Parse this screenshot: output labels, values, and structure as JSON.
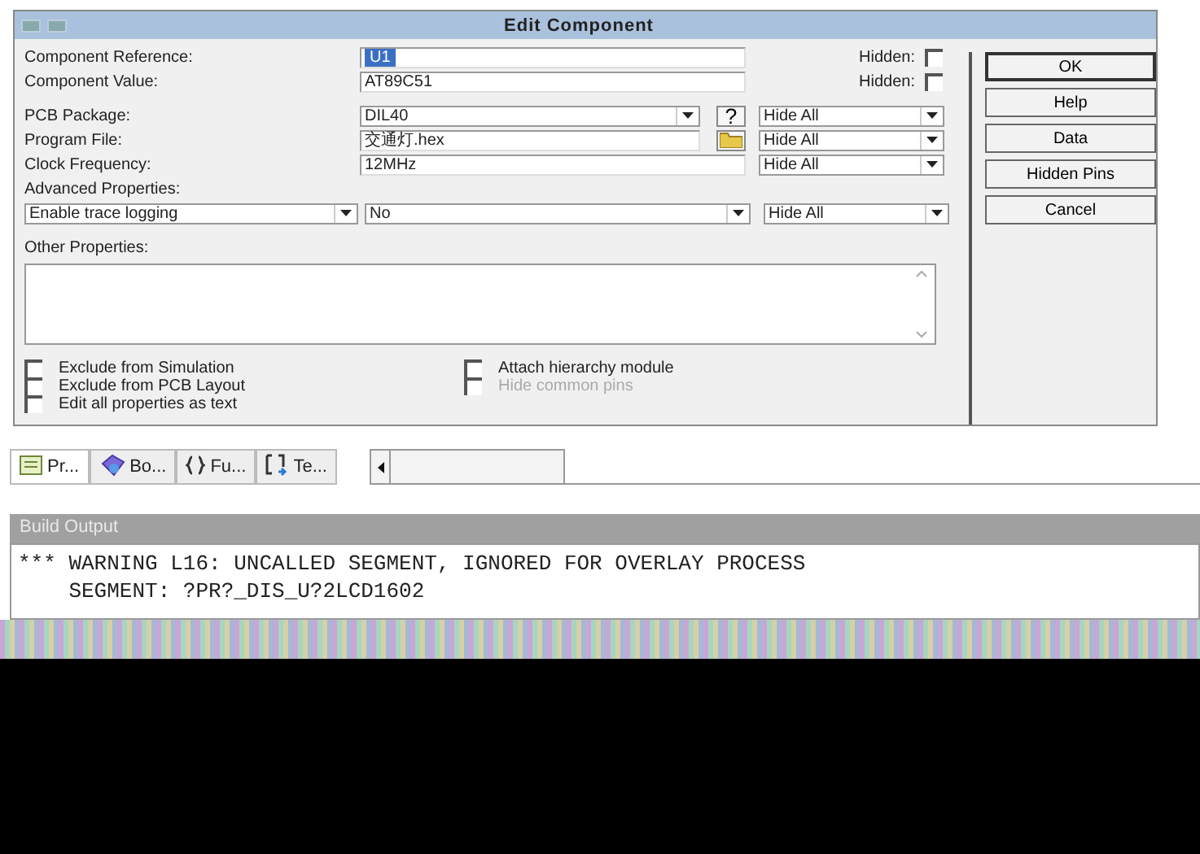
{
  "window": {
    "title": "Edit Component"
  },
  "fields": [
    {
      "kind": "text",
      "label": "Component Reference:",
      "value": "U1",
      "highlighted": true,
      "hidden_label": "Hidden:",
      "hidden_checked": false
    },
    {
      "kind": "text",
      "label": "Component Value:",
      "value": "AT89C51",
      "highlighted": false,
      "hidden_label": "Hidden:",
      "hidden_checked": false
    },
    {
      "kind": "package",
      "label": "PCB Package:",
      "value": "DIL40",
      "button": "?",
      "visibility": "Hide All"
    },
    {
      "kind": "file",
      "label": "Program File:",
      "value": "交通灯.hex",
      "visibility": "Hide All"
    },
    {
      "kind": "plain",
      "label": "Clock Frequency:",
      "value": "12MHz",
      "visibility": "Hide All"
    }
  ],
  "advanced": {
    "label": "Advanced Properties:",
    "property": "Enable trace logging",
    "value": "No",
    "visibility": "Hide All"
  },
  "other_properties": {
    "label": "Other Properties:"
  },
  "option_columns": [
    [
      {
        "label": "Exclude from Simulation",
        "checked": false,
        "disabled": false
      },
      {
        "label": "Exclude from PCB Layout",
        "checked": false,
        "disabled": false
      },
      {
        "label": "Edit all properties as text",
        "checked": false,
        "disabled": false
      }
    ],
    [
      {
        "label": "Attach hierarchy module",
        "checked": false,
        "disabled": false
      },
      {
        "label": "Hide common pins",
        "checked": false,
        "disabled": true
      }
    ]
  ],
  "buttons": [
    {
      "label": "OK",
      "default": true
    },
    {
      "label": "Help",
      "default": false
    },
    {
      "label": "Data",
      "default": false
    },
    {
      "label": "Hidden Pins",
      "default": false
    },
    {
      "label": "Cancel",
      "default": false
    }
  ],
  "panel_tabs": [
    {
      "label": "Pr...",
      "selected": true
    },
    {
      "label": "Bo...",
      "selected": false
    },
    {
      "label": "Fu...",
      "selected": false
    },
    {
      "label": "Te...",
      "selected": false
    }
  ],
  "build_output": {
    "title": "Build Output",
    "lines": [
      "*** WARNING L16: UNCALLED SEGMENT, IGNORED FOR OVERLAY PROCESS",
      "    SEGMENT: ?PR?_DIS_U?2LCD1602"
    ]
  }
}
